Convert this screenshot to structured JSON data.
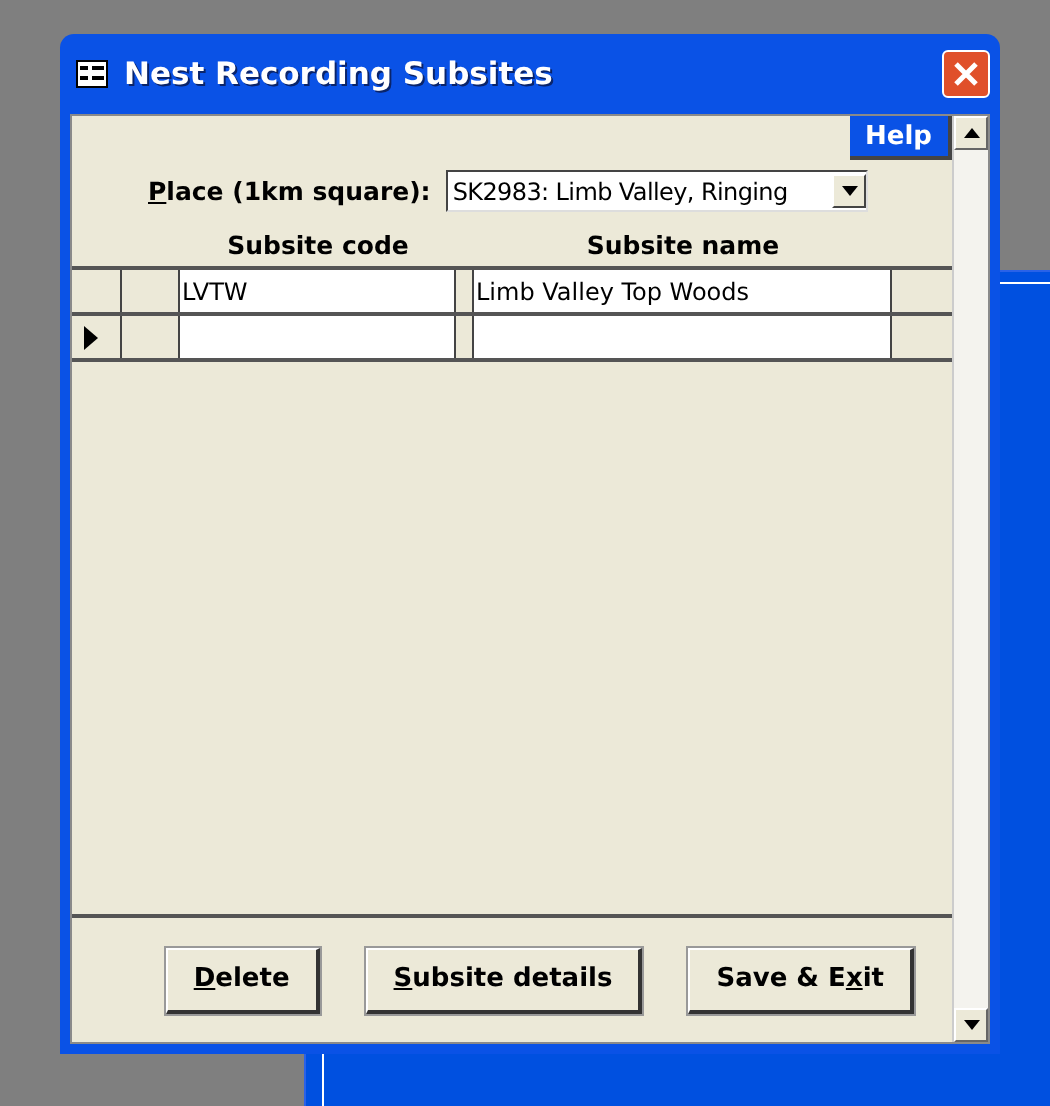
{
  "window": {
    "title": "Nest Recording Subsites"
  },
  "help_button": {
    "label": "Help"
  },
  "place": {
    "hotkey": "P",
    "label_after": "lace (1km square):",
    "value": "SK2983: Limb Valley, Ringing"
  },
  "grid": {
    "columns": [
      "Subsite code",
      "Subsite name"
    ],
    "rows": [
      {
        "code": "LVTW",
        "name": "Limb Valley Top Woods",
        "selected": false
      },
      {
        "selected": true
      }
    ]
  },
  "buttons": [
    {
      "hotkey": "D",
      "after": "elete"
    },
    {
      "hotkey": "S",
      "after": "ubsite details"
    },
    {
      "before": "Save & E",
      "hotkey": "x",
      "after": "it"
    }
  ]
}
